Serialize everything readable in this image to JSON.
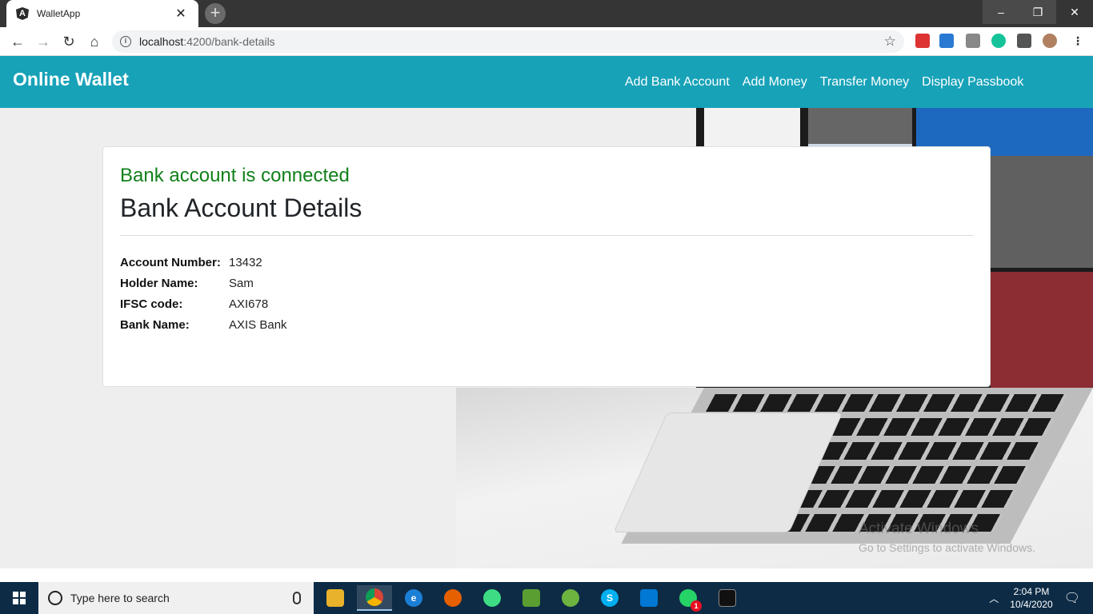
{
  "browser": {
    "tab_title": "WalletApp",
    "tab_close": "✕",
    "new_tab": "+",
    "url_host": "localhost",
    "url_path": ":4200/bank-details",
    "window_controls": {
      "minimize": "–",
      "maximize": "❐",
      "close": "✕"
    }
  },
  "app": {
    "brand": "Online Wallet",
    "nav": [
      "Add Bank Account",
      "Add Money",
      "Transfer Money",
      "Display Passbook"
    ],
    "status_message": "Bank account is connected",
    "card_title": "Bank Account Details",
    "details": [
      {
        "label": "Account Number:",
        "value": "13432"
      },
      {
        "label": "Holder Name:",
        "value": "Sam"
      },
      {
        "label": "IFSC code:",
        "value": "AXI678"
      },
      {
        "label": "Bank Name:",
        "value": "AXIS Bank"
      }
    ]
  },
  "watermark": {
    "title": "Activate Windows",
    "subtitle": "Go to Settings to activate Windows."
  },
  "taskbar": {
    "search_placeholder": "Type here to search",
    "time": "2:04 PM",
    "date": "10/4/2020",
    "notification_badge": "1"
  },
  "colors": {
    "navbar": "#17a2b8",
    "status_green": "#11801a",
    "taskbar": "#0d2b45"
  }
}
